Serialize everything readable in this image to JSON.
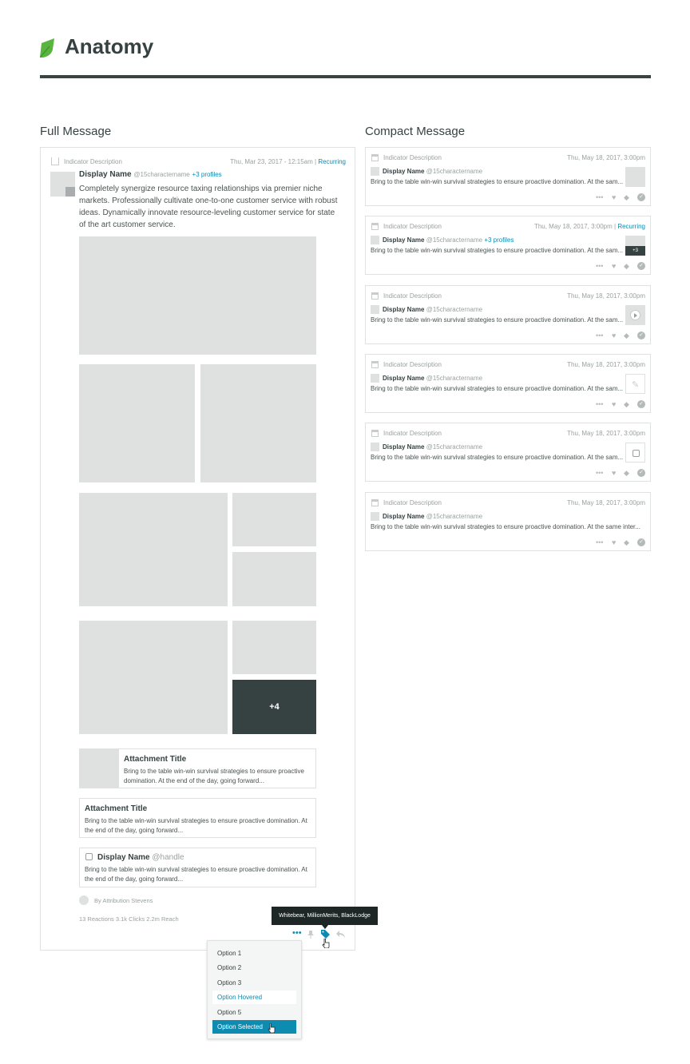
{
  "page": {
    "title": "Anatomy",
    "brand_color": "#59b53f",
    "accent_color": "#0d8bb0"
  },
  "sections": {
    "full_title": "Full Message",
    "compact_title": "Compact Message"
  },
  "full_message": {
    "indicator": "Indicator Description",
    "date": "Thu, Mar 23, 2017 - 12:15am |",
    "recurring": "Recurring",
    "display_name": "Display Name",
    "handle": "@15charactername",
    "profiles": "+3 profiles",
    "body": "Completely synergize resource taxing relationships via premier niche markets. Professionally cultivate one-to-one customer service with robust ideas. Dynamically innovate resource-leveling customer service for state of the art customer service.",
    "more_images": "+4",
    "attachments": [
      {
        "title": "Attachment Title",
        "desc": "Bring to the table win-win survival strategies to ensure proactive domination. At the end of the day, going forward..."
      },
      {
        "title": "Attachment Title",
        "desc": "Bring to the table win-win survival strategies to ensure proactive domination. At the end of the day, going forward..."
      }
    ],
    "quoted": {
      "name": "Display Name",
      "handle": "@handle",
      "desc": "Bring to the table win-win survival strategies to ensure proactive domination. At the end of the day, going forward..."
    },
    "attribution": "By Attribution Stevens",
    "stats": "13 Reactions   3.1k Clicks   2.2m Reach",
    "tooltip": "Whitebear, MillionMerits, BlackLodge",
    "dropdown_options": [
      "Option 1",
      "Option 2",
      "Option 3",
      "Option Hovered",
      "Option 5",
      "Option Selected"
    ],
    "actions": [
      "more-icon",
      "pin-icon",
      "tag-icon",
      "reply-icon"
    ]
  },
  "compact_messages": [
    {
      "indicator": "Indicator Description",
      "date": "Thu, May 18, 2017, 3:00pm",
      "recurring": "",
      "name": "Display Name",
      "handle": "@15charactername",
      "profiles": "",
      "body": "Bring to the table win-win survival strategies to ensure proactive domination. At the sam...",
      "media": "image"
    },
    {
      "indicator": "Indicator Description",
      "date": "Thu, May 18, 2017, 3:00pm |",
      "recurring": "Recurring",
      "name": "Display Name",
      "handle": "@15charactername",
      "profiles": "+3 profiles",
      "body": "Bring to the table win-win survival strategies to ensure proactive domination. At the sam...",
      "media": "image-multiple",
      "badge": "+3"
    },
    {
      "indicator": "Indicator Description",
      "date": "Thu, May 18, 2017, 3:00pm",
      "recurring": "",
      "name": "Display Name",
      "handle": "@15charactername",
      "profiles": "",
      "body": "Bring to the table win-win survival strategies to ensure proactive domination. At the sam...",
      "media": "video"
    },
    {
      "indicator": "Indicator Description",
      "date": "Thu, May 18, 2017, 3:00pm",
      "recurring": "",
      "name": "Display Name",
      "handle": "@15charactername",
      "profiles": "",
      "body": "Bring to the table win-win survival strategies to ensure proactive domination. At the sam...",
      "media": "attachment"
    },
    {
      "indicator": "Indicator Description",
      "date": "Thu, May 18, 2017, 3:00pm",
      "recurring": "",
      "name": "Display Name",
      "handle": "@15charactername",
      "profiles": "",
      "body": "Bring to the table win-win survival strategies to ensure proactive domination. At the sam...",
      "media": "quote"
    },
    {
      "indicator": "Indicator Description",
      "date": "Thu, May 18, 2017, 3:00pm",
      "recurring": "",
      "name": "Display Name",
      "handle": "@15charactername",
      "profiles": "",
      "body": "Bring to the table win-win survival strategies to ensure proactive domination. At the same inter...",
      "media": "none"
    }
  ]
}
